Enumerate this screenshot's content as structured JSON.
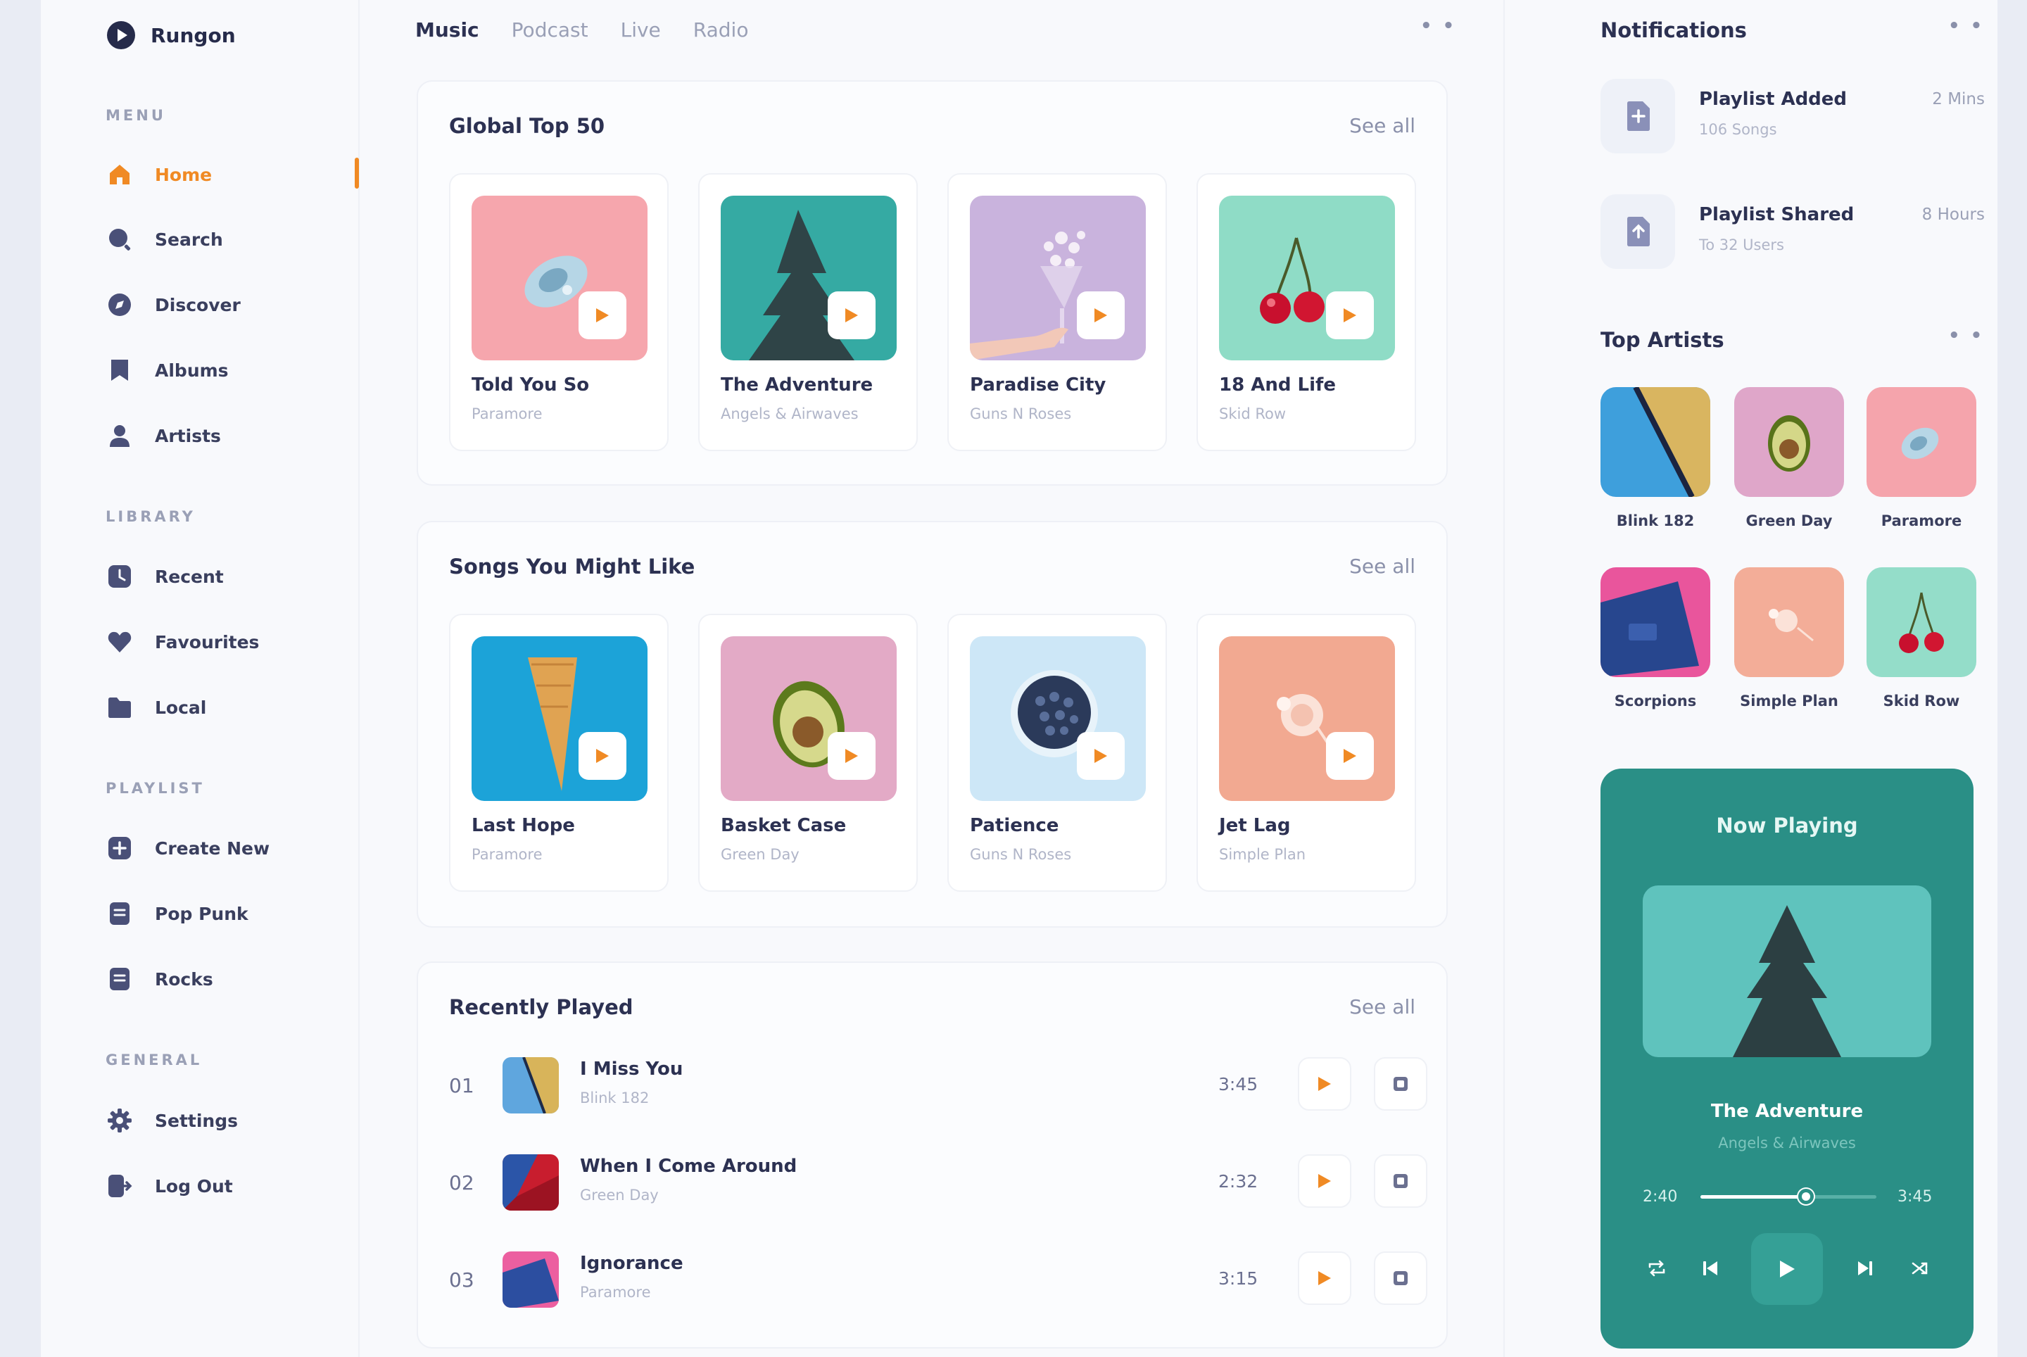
{
  "brand": {
    "name": "Rungon"
  },
  "sidebar": {
    "menu_title": "MENU",
    "menu": [
      {
        "label": "Home",
        "icon": "home-icon",
        "active": true
      },
      {
        "label": "Search",
        "icon": "search-icon"
      },
      {
        "label": "Discover",
        "icon": "compass-icon"
      },
      {
        "label": "Albums",
        "icon": "album-icon"
      },
      {
        "label": "Artists",
        "icon": "user-icon"
      }
    ],
    "library_title": "LIBRARY",
    "library": [
      {
        "label": "Recent",
        "icon": "clock-icon"
      },
      {
        "label": "Favourites",
        "icon": "heart-icon"
      },
      {
        "label": "Local",
        "icon": "folder-icon"
      }
    ],
    "playlist_title": "PLAYLIST",
    "playlist": [
      {
        "label": "Create New",
        "icon": "plus-icon"
      },
      {
        "label": "Pop Punk",
        "icon": "list-icon"
      },
      {
        "label": "Rocks",
        "icon": "list-icon"
      }
    ],
    "general_title": "GENERAL",
    "general": [
      {
        "label": "Settings",
        "icon": "gear-icon"
      },
      {
        "label": "Log Out",
        "icon": "logout-icon"
      }
    ]
  },
  "tabs": [
    "Music",
    "Podcast",
    "Live",
    "Radio"
  ],
  "global_top": {
    "title": "Global Top 50",
    "see_all": "See all",
    "items": [
      {
        "title": "Told You So",
        "artist": "Paramore"
      },
      {
        "title": "The Adventure",
        "artist": "Angels & Airwaves"
      },
      {
        "title": "Paradise City",
        "artist": "Guns N Roses"
      },
      {
        "title": "18 And Life",
        "artist": "Skid Row"
      }
    ]
  },
  "might_like": {
    "title": "Songs You Might Like",
    "see_all": "See all",
    "items": [
      {
        "title": "Last Hope",
        "artist": "Paramore"
      },
      {
        "title": "Basket Case",
        "artist": "Green Day"
      },
      {
        "title": "Patience",
        "artist": "Guns N Roses"
      },
      {
        "title": "Jet Lag",
        "artist": "Simple Plan"
      }
    ]
  },
  "recently_played": {
    "title": "Recently Played",
    "see_all": "See all",
    "rows": [
      {
        "num": "01",
        "title": "I Miss You",
        "artist": "Blink 182",
        "time": "3:45"
      },
      {
        "num": "02",
        "title": "When I Come Around",
        "artist": "Green Day",
        "time": "2:32"
      },
      {
        "num": "03",
        "title": "Ignorance",
        "artist": "Paramore",
        "time": "3:15"
      }
    ]
  },
  "notifications": {
    "title": "Notifications",
    "items": [
      {
        "title": "Playlist Added",
        "sub": "106 Songs",
        "time": "2 Mins"
      },
      {
        "title": "Playlist Shared",
        "sub": "To 32 Users",
        "time": "8 Hours"
      }
    ]
  },
  "top_artists": {
    "title": "Top Artists",
    "items": [
      "Blink 182",
      "Green Day",
      "Paramore",
      "Scorpions",
      "Simple Plan",
      "Skid Row"
    ]
  },
  "now_playing": {
    "label": "Now Playing",
    "title": "The Adventure",
    "artist": "Angels & Airwaves",
    "elapsed": "2:40",
    "duration": "3:45",
    "progress": 0.6
  },
  "colors": {
    "accent": "#f08a24",
    "player_bg": "#2a8f86",
    "text_dark": "#2c3152"
  }
}
